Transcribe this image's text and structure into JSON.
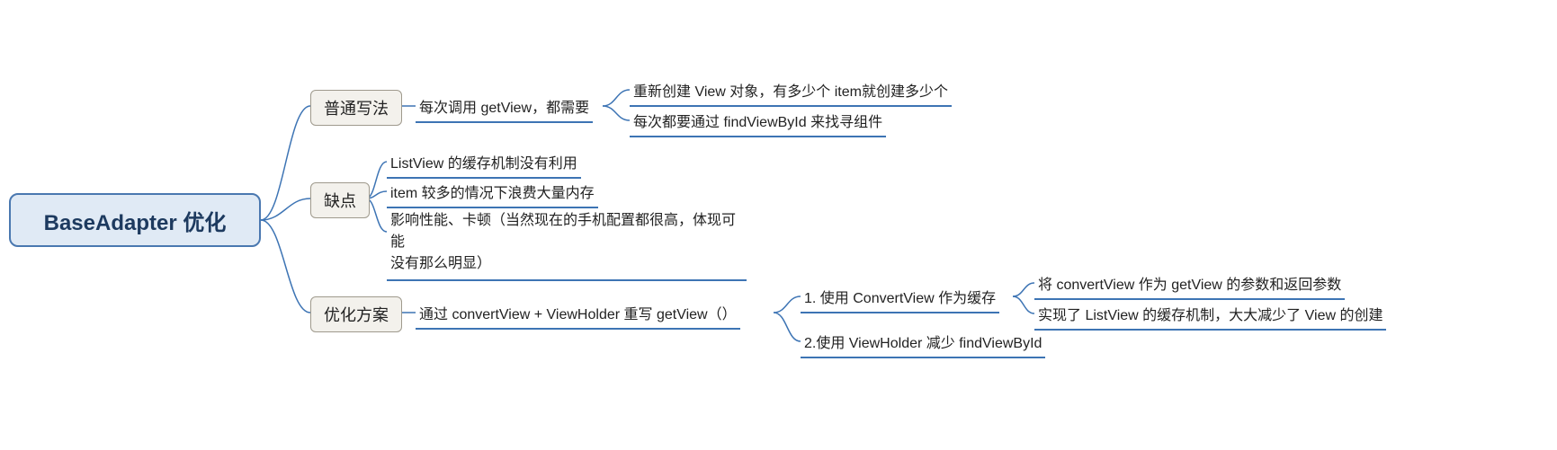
{
  "root": "BaseAdapter 优化",
  "branches": {
    "normal": "普通写法",
    "cons": "缺点",
    "plan": "优化方案"
  },
  "normal": {
    "intro": "每次调用 getView，都需要",
    "sub1": "重新创建 View 对象，有多少个 item就创建多少个",
    "sub2": "每次都要通过 findViewById 来找寻组件"
  },
  "cons": {
    "c1": "ListView 的缓存机制没有利用",
    "c2": "item 较多的情况下浪费大量内存",
    "c3_line1": "影响性能、卡顿（当然现在的手机配置都很高，体现可能",
    "c3_line2": "没有那么明显）"
  },
  "plan": {
    "intro": "通过 convertView + ViewHolder 重写 getView（）",
    "s1": "1. 使用 ConvertView 作为缓存",
    "s1a": "将 convertView 作为 getView  的参数和返回参数",
    "s1b": "实现了 ListView 的缓存机制，大大减少了 View 的创建",
    "s2": "2.使用 ViewHolder 减少 findViewById"
  }
}
